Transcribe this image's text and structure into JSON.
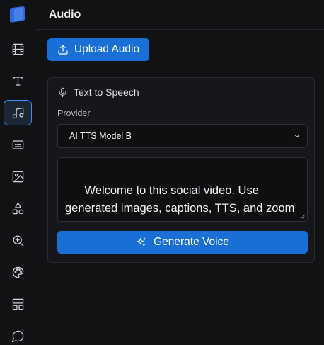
{
  "header": {
    "title": "Audio"
  },
  "toolbar": {
    "upload_label": "Upload Audio"
  },
  "sidebar": {
    "items": [
      {
        "icon": "film-icon",
        "active": false
      },
      {
        "icon": "text-icon",
        "active": false
      },
      {
        "icon": "music-icon",
        "active": true
      },
      {
        "icon": "captions-icon",
        "active": false
      },
      {
        "icon": "image-icon",
        "active": false
      },
      {
        "icon": "shapes-icon",
        "active": false
      },
      {
        "icon": "zoom-icon",
        "active": false
      },
      {
        "icon": "palette-icon",
        "active": false
      },
      {
        "icon": "layout-icon",
        "active": false
      },
      {
        "icon": "chat-icon",
        "active": false
      }
    ]
  },
  "tts": {
    "title": "Text to Speech",
    "provider_label": "Provider",
    "provider_value": "AI TTS Model B",
    "text": "Welcome to this social video. Use generated images, captions, TTS, and zoom effects to build a complete story.",
    "generate_label": "Generate Voice"
  },
  "colors": {
    "accent": "#1a6fd6",
    "active_border": "#3b8ef5",
    "background": "#111214"
  }
}
